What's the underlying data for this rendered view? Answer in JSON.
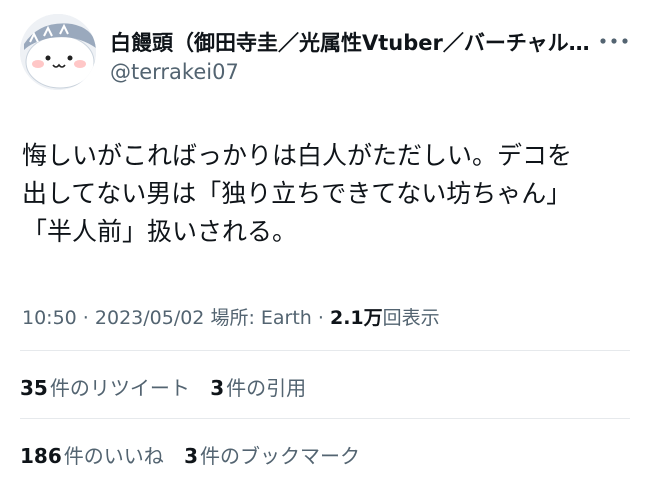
{
  "author": {
    "display_name": "白饅頭（御田寺圭／光属性Vtuber／バーチャル無職）",
    "handle": "@terrakei07",
    "avatar_icon": "avatar-character-icon"
  },
  "more_icon": "more-horizontal-icon",
  "tweet": {
    "text": "悔しいがこればっかりは白人がただしい。デコを\n出してない男は「独り立ちできてない坊ちゃん」\n「半人前」扱いされる。"
  },
  "meta": {
    "time": "10:50",
    "sep1": " · ",
    "date": "2023/05/02",
    "location": " 場所: Earth",
    "sep2": " · ",
    "views_count": "2.1万",
    "views_label": "回表示"
  },
  "stats": {
    "retweets_count": "35",
    "retweets_label": "件のリツイート",
    "quotes_count": "3",
    "quotes_label": "件の引用",
    "likes_count": "186",
    "likes_label": "件のいいね",
    "bookmarks_count": "3",
    "bookmarks_label": "件のブックマーク"
  },
  "colors": {
    "text": "#0f1419",
    "secondary": "#536471",
    "divider": "#e6e9ec"
  }
}
